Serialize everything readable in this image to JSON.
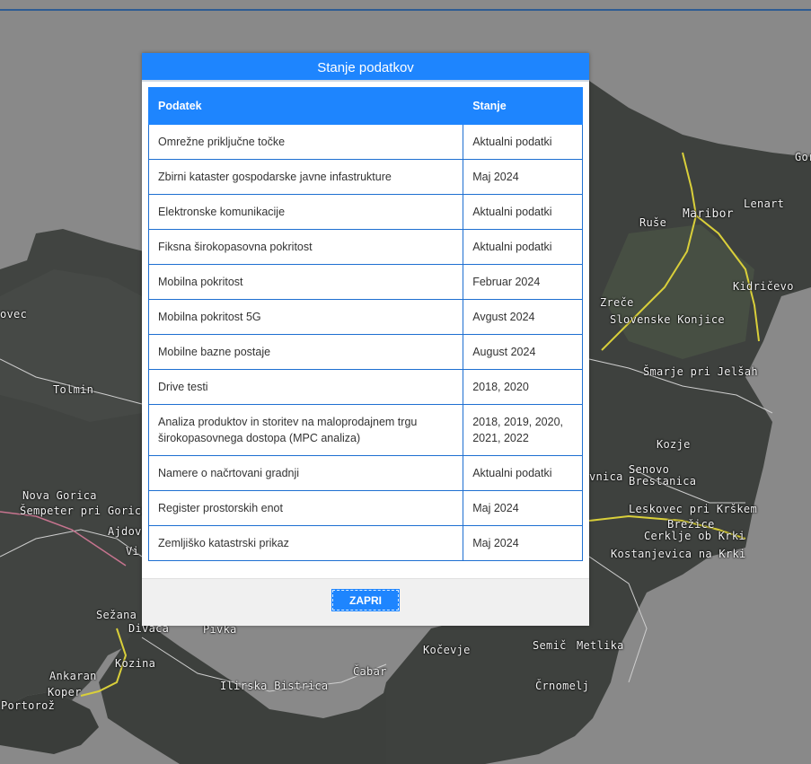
{
  "modal": {
    "title": "Stanje podatkov",
    "columns": [
      "Podatek",
      "Stanje"
    ],
    "rows": [
      {
        "podatek": "Omrežne priključne točke",
        "stanje": "Aktualni podatki"
      },
      {
        "podatek": "Zbirni kataster gospodarske javne infastrukture",
        "stanje": "Maj 2024"
      },
      {
        "podatek": "Elektronske komunikacije",
        "stanje": "Aktualni podatki"
      },
      {
        "podatek": "Fiksna širokopasovna pokritost",
        "stanje": "Aktualni podatki"
      },
      {
        "podatek": "Mobilna pokritost",
        "stanje": "Februar 2024"
      },
      {
        "podatek": "Mobilna pokritost 5G",
        "stanje": "Avgust 2024"
      },
      {
        "podatek": "Mobilne bazne postaje",
        "stanje": "August 2024"
      },
      {
        "podatek": "Drive testi",
        "stanje": "2018, 2020"
      },
      {
        "podatek": "Analiza produktov in storitev na maloprodajnem trgu širokopasovnega dostopa (MPC analiza)",
        "stanje": "2018, 2019, 2020, 2021, 2022"
      },
      {
        "podatek": "Namere o načrtovani gradnji",
        "stanje": "Aktualni podatki"
      },
      {
        "podatek": "Register prostorskih enot",
        "stanje": "Maj 2024"
      },
      {
        "podatek": "Zemljiško katastrski prikaz",
        "stanje": "Maj 2024"
      }
    ],
    "close_label": "ZAPRI"
  },
  "map": {
    "labels": [
      "Maribor",
      "Lenart",
      "Ruše",
      "Kidričevo",
      "Zreče",
      "Slovenske Konjice",
      "Šmarje pri Jelšah",
      "Kozje",
      "Senovo",
      "Brestanica",
      "Leskovec pri Krškem",
      "Brežice",
      "Cerklje ob Krki",
      "Kostanjevica na Krki",
      "vnica",
      "Semič",
      "Metlika",
      "Črnomelj",
      "Kočevje",
      "Čabar",
      "Ilirska Bistrica",
      "Pivka",
      "Divača",
      "Sežana",
      "Kozina",
      "Ankaran",
      "Koper",
      "Portorož",
      "Nova Gorica",
      "Šempeter pri Gorici",
      "Ajdov",
      "Vi",
      "Tolmin",
      "ovec",
      "Gor"
    ],
    "colors": {
      "overlay": "#898989",
      "land": "#3c3f3c",
      "roads": "#e8e04a",
      "borders": "#d9d9d9"
    }
  },
  "colors": {
    "accent": "#1e85fe",
    "table_border": "#1e6fd1",
    "footer_bg": "#f0f0f0"
  }
}
